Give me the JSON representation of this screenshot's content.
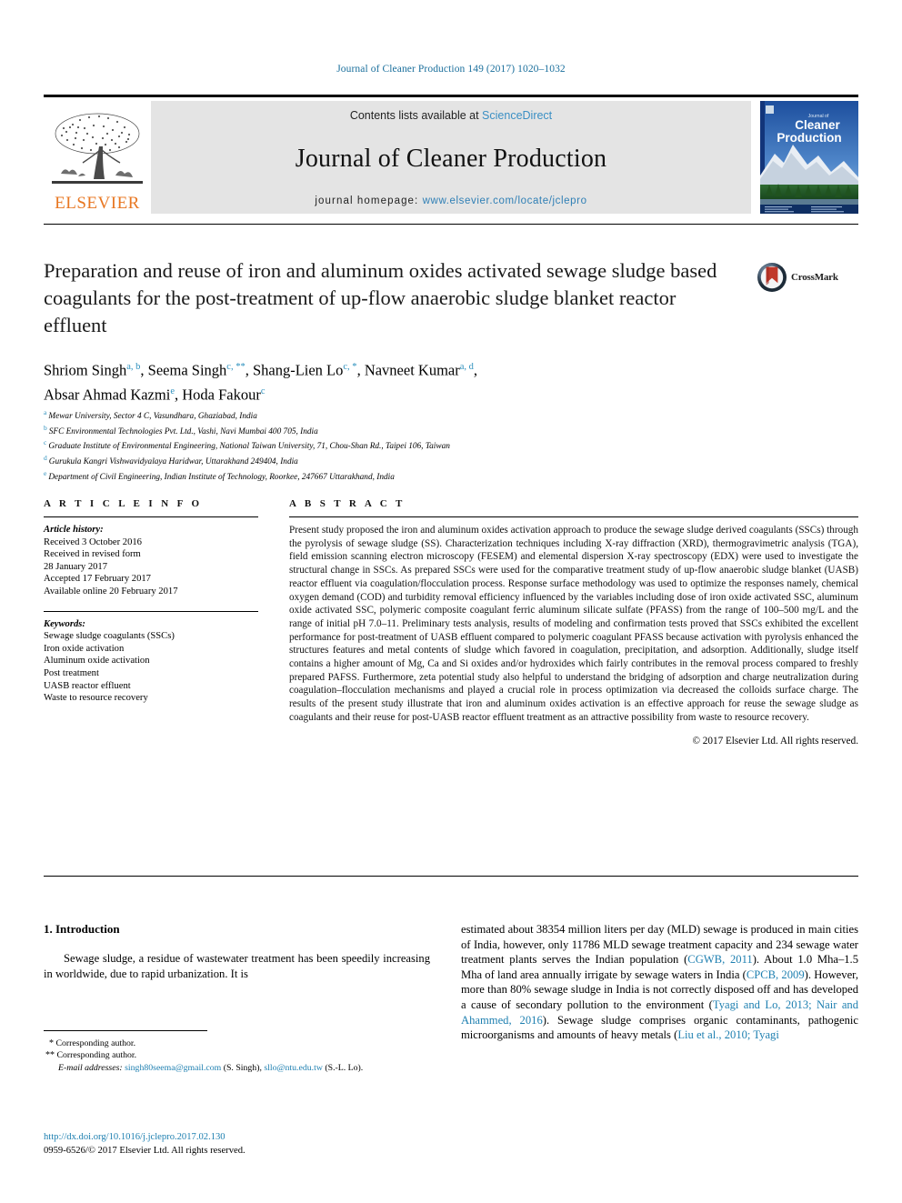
{
  "running_head": "Journal of Cleaner Production 149 (2017) 1020–1032",
  "masthead": {
    "contents_prefix": "Contents lists available at ",
    "sciencedirect": "ScienceDirect",
    "journal_title": "Journal of Cleaner Production",
    "homepage_prefix": "journal homepage: ",
    "homepage_url": "www.elsevier.com/locate/jclepro",
    "publisher": "ELSEVIER",
    "cover_title_small": "Journal of",
    "cover_title_line1": "Cleaner",
    "cover_title_line2": "Production",
    "link_color": "#2f7fb5",
    "band_color": "#e4e4e4",
    "elsevier_orange": "#e87722"
  },
  "article": {
    "title": "Preparation and reuse of iron and aluminum oxides activated sewage sludge based coagulants for the post-treatment of up-flow anaerobic sludge blanket reactor effluent",
    "crossmark_label": "CrossMark",
    "authors_line1": "Shriom Singh ",
    "authors": [
      {
        "name": "Shriom Singh",
        "marks": "a, b"
      },
      {
        "name": "Seema Singh",
        "marks": "c, **"
      },
      {
        "name": "Shang-Lien Lo",
        "marks": "c, *"
      },
      {
        "name": "Navneet Kumar",
        "marks": "a, d"
      },
      {
        "name": "Absar Ahmad Kazmi",
        "marks": "e"
      },
      {
        "name": "Hoda Fakour",
        "marks": "c"
      }
    ],
    "affiliations": [
      {
        "label": "a",
        "text": "Mewar University, Sector 4 C, Vasundhara, Ghaziabad, India"
      },
      {
        "label": "b",
        "text": "SFC Environmental Technologies Pvt. Ltd., Vashi, Navi Mumbai 400 705, India"
      },
      {
        "label": "c",
        "text": "Graduate Institute of Environmental Engineering, National Taiwan University, 71, Chou-Shan Rd., Taipei 106, Taiwan"
      },
      {
        "label": "d",
        "text": "Gurukula Kangri Vishwavidyalaya Haridwar, Uttarakhand 249404, India"
      },
      {
        "label": "e",
        "text": "Department of Civil Engineering, Indian Institute of Technology, Roorkee, 247667 Uttarakhand, India"
      }
    ]
  },
  "article_info": {
    "heading": "A R T I C L E   I N F O",
    "history_title": "Article history:",
    "history": [
      "Received 3 October 2016",
      "Received in revised form",
      "28 January 2017",
      "Accepted 17 February 2017",
      "Available online 20 February 2017"
    ],
    "keywords_title": "Keywords:",
    "keywords": [
      "Sewage sludge coagulants (SSCs)",
      "Iron oxide activation",
      "Aluminum oxide activation",
      "Post treatment",
      "UASB reactor effluent",
      "Waste to resource recovery"
    ]
  },
  "abstract": {
    "heading": "A B S T R A C T",
    "text": "Present study proposed the iron and aluminum oxides activation approach to produce the sewage sludge derived coagulants (SSCs) through the pyrolysis of sewage sludge (SS). Characterization techniques including X-ray diffraction (XRD), thermogravimetric analysis (TGA), field emission scanning electron microscopy (FESEM) and elemental dispersion X-ray spectroscopy (EDX) were used to investigate the structural change in SSCs. As prepared SSCs were used for the comparative treatment study of up-flow anaerobic sludge blanket (UASB) reactor effluent via coagulation/flocculation process. Response surface methodology was used to optimize the responses namely, chemical oxygen demand (COD) and turbidity removal efficiency influenced by the variables including dose of iron oxide activated SSC, aluminum oxide activated SSC, polymeric composite coagulant ferric aluminum silicate sulfate (PFASS) from the range of 100–500 mg/L and the range of initial pH 7.0–11. Preliminary tests analysis, results of modeling and confirmation tests proved that SSCs exhibited the excellent performance for post-treatment of UASB effluent compared to polymeric coagulant PFASS because activation with pyrolysis enhanced the structures features and metal contents of sludge which favored in coagulation, precipitation, and adsorption. Additionally, sludge itself contains a higher amount of Mg, Ca and Si oxides and/or hydroxides which fairly contributes in the removal process compared to freshly prepared PAFSS. Furthermore, zeta potential study also helpful to understand the bridging of adsorption and charge neutralization during coagulation–flocculation mechanisms and played a crucial role in process optimization via decreased the colloids surface charge. The results of the present study illustrate that iron and aluminum oxides activation is an effective approach for reuse the sewage sludge as coagulants and their reuse for post-UASB reactor effluent treatment as an attractive possibility from waste to resource recovery.",
    "copyright": "© 2017 Elsevier Ltd. All rights reserved."
  },
  "body": {
    "section_heading": "1. Introduction",
    "left_paragraph": "Sewage sludge, a residue of wastewater treatment has been speedily increasing in worldwide, due to rapid urbanization. It is",
    "right_par_a": "estimated about 38354 million liters per day (MLD) sewage is produced in main cities of India, however, only 11786 MLD sewage treatment capacity and 234 sewage water treatment plants serves the Indian population (",
    "right_ref_1": "CGWB, 2011",
    "right_par_b": "). About 1.0 Mha–1.5 Mha of land area annually irrigate by sewage waters in India (",
    "right_ref_2": "CPCB, 2009",
    "right_par_c": "). However, more than 80% sewage sludge in India is not correctly disposed off and has developed a cause of secondary pollution to the environment (",
    "right_ref_3": "Tyagi and Lo, 2013; Nair and Ahammed, 2016",
    "right_par_d": "). Sewage sludge comprises organic contaminants, pathogenic microorganisms and amounts of heavy metals (",
    "right_ref_4": "Liu et al., 2010; Tyagi"
  },
  "footnotes": {
    "star_single": "*",
    "corresponding_1": " Corresponding author.",
    "star_double": "**",
    "corresponding_2": " Corresponding author.",
    "email_label": "E-mail addresses:",
    "email_1": "singh80seema@gmail.com",
    "email_1_owner": " (S. Singh), ",
    "email_2": "sllo@ntu.edu.tw",
    "email_2_owner": " (S.-L. Lo).",
    "doi": "http://dx.doi.org/10.1016/j.jclepro.2017.02.130",
    "issn_line": "0959-6526/© 2017 Elsevier Ltd. All rights reserved."
  }
}
